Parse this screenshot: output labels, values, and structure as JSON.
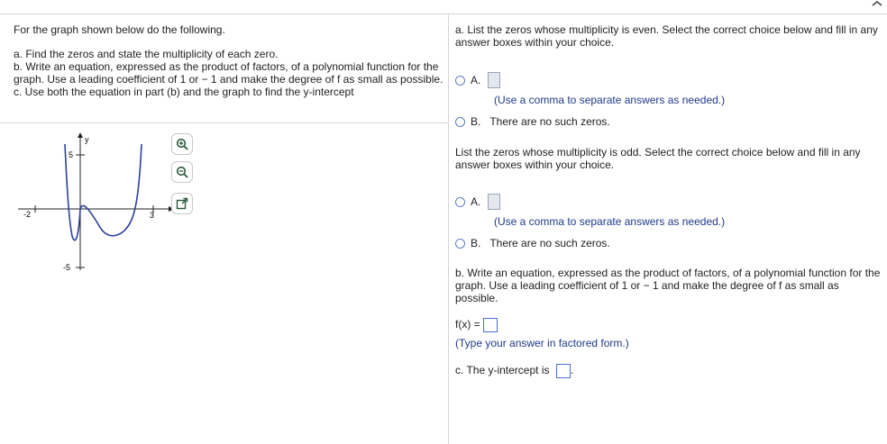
{
  "left": {
    "intro": "For the graph shown below do the following.",
    "part_a": "a. Find the zeros and state the multiplicity of each zero.",
    "part_b": "b. Write an equation, expressed as the product of factors, of a polynomial function for the graph. Use a leading coefficient of 1 or − 1 and make the degree of f as small as possible.",
    "part_c": "c. Use both the equation in part (b) and the graph to find the y-intercept"
  },
  "graph": {
    "y_axis_label": "y",
    "tick_y_top": "5",
    "tick_y_bottom": "-5",
    "tick_x_left": "-2",
    "tick_x_right": "3",
    "curve_color": "#2b3f9e",
    "tools": [
      "zoom-in-icon",
      "zoom-out-icon",
      "popout-icon"
    ]
  },
  "right": {
    "q1": "a. List the zeros whose multiplicity is even. Select the correct choice below and fill in any answer boxes within your choice.",
    "q1_a_label": "A.",
    "q1_hint": "(Use a comma to separate answers as needed.)",
    "q1_b_label": "B.",
    "q1_b_text": "There are no such zeros.",
    "q2": "List the zeros whose multiplicity is odd. Select the correct choice below and fill in any answer boxes within your choice.",
    "q2_a_label": "A.",
    "q2_hint": "(Use a comma to separate answers as needed.)",
    "q2_b_label": "B.",
    "q2_b_text": "There are no such zeros.",
    "q3": "b. Write an equation, expressed as the product of factors, of a polynomial function for the graph. Use a leading coefficient of 1 or − 1 and make the degree of f as small as possible.",
    "fx_label": "f(x) =",
    "fx_hint": "(Type your answer in factored form.)",
    "yint_label": "c. The y-intercept is",
    "yint_suffix": "."
  }
}
